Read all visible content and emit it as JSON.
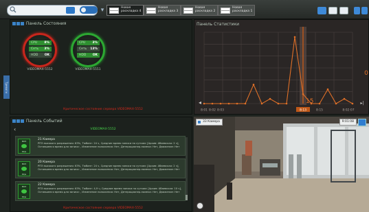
{
  "toolbar": {
    "layouts": [
      {
        "label": "Новая раскладка 4",
        "active": true
      },
      {
        "label": "Новая раскладка 3",
        "active": false
      },
      {
        "label": "Новая раскладка 2",
        "active": false
      },
      {
        "label": "Новая раскладка 1",
        "active": false
      }
    ]
  },
  "status_panel": {
    "title": "Панель Состояния",
    "servers": [
      {
        "name": "VIDEOMAX-5552",
        "cpu_label": "CPU",
        "cpu": "8%",
        "net_label": "Сеть",
        "net": "3%",
        "hdd_label": "HDD",
        "hdd": "OK",
        "state": "red"
      },
      {
        "name": "VIDEOMAX-5551",
        "cpu_label": "CPU",
        "cpu": "3%",
        "net_label": "Сеть",
        "net": "13%",
        "hdd_label": "HDD",
        "hdd": "OK",
        "state": "green"
      }
    ],
    "warning": "Критическое состояние сервера VIDEOMAX-5552",
    "side_tab": "Тревоги"
  },
  "stats_panel": {
    "title": "Панель Статистики",
    "right_value": "0",
    "cursor_value": "15"
  },
  "chart_data": {
    "type": "line",
    "x": [
      "8:01",
      "8:02",
      "8:03",
      "8:04",
      "8:05",
      "8:06",
      "8:07",
      "8:08",
      "8:09",
      "8:10",
      "8:11",
      "8:12",
      "8:13",
      "8:14",
      "8:15",
      "8:16",
      "8:17",
      "8:18",
      "8:19"
    ],
    "series": [
      {
        "values": [
          0,
          0,
          0,
          0,
          0,
          0,
          4,
          0,
          1,
          0,
          0,
          14,
          2,
          0,
          0,
          3,
          0,
          1,
          0
        ]
      }
    ],
    "tick_labels": [
      "8:01",
      "8:02",
      "8:03",
      "8:13",
      "8:15",
      "8:02:07"
    ],
    "selected": "8:13",
    "ylim": [
      0,
      15
    ],
    "grid": true
  },
  "events_panel": {
    "title": "Панель Событий",
    "server": "VIDEOMAX-5552",
    "footer_warning": "Критическое состояние сервера VIDEOMAX-5552",
    "events": [
      {
        "title": "21 Камера",
        "thumb_top": "ВОЗ",
        "thumb_bottom": "Ж/м",
        "text": "РП3 высокого разрешения: 63%, Тюбинг: 24 ч, Средние время записи по суткам: [Архив: Абаевская: 2 ч], Оставшееся время для записи: , Изменение положения: Нет, Детерационер-помеха: Нет, Движение: Нет"
      },
      {
        "title": "20 Камера",
        "thumb_top": "ВОЗ",
        "thumb_bottom": "Ж/м",
        "text": "РП3 высокого разрешения: 63%, Тюбинг: 24 ч, Средние время записи по суткам: [Архив: Абаевская: 2 ч], Оставшееся время для записи: , Изменение положения: Нет, Детерационер-помеха: Нет, Движение: Нет"
      },
      {
        "title": "22 Камера",
        "thumb_top": "ВОЗ",
        "thumb_bottom": "Ж/м",
        "text": "РП3 высокого разрешения: 63%, Тюбинг: 4,9 ч, Средние время записи по суткам: [Архив: Абаевская: 10 ч], Оставшееся время для записи: , Изменение положения: Нет, Детерационер-помеха: Нет, Движение: Нет"
      }
    ]
  },
  "camera_panel": {
    "name": "33 Камера",
    "time": "9:01:08"
  },
  "colors": {
    "critical": "#d8281c",
    "ok": "#2ca832",
    "accent": "#3e8ad8",
    "chart_line": "#e07028",
    "chart_cursor": "#c05818"
  },
  "icons": [
    "search-icon",
    "grid-layout-icon",
    "view-toggle-icon",
    "chevron-down-icon",
    "layout-icon",
    "fullscreen-icon",
    "settings-icon",
    "back-arrow-icon",
    "camera-icon"
  ]
}
